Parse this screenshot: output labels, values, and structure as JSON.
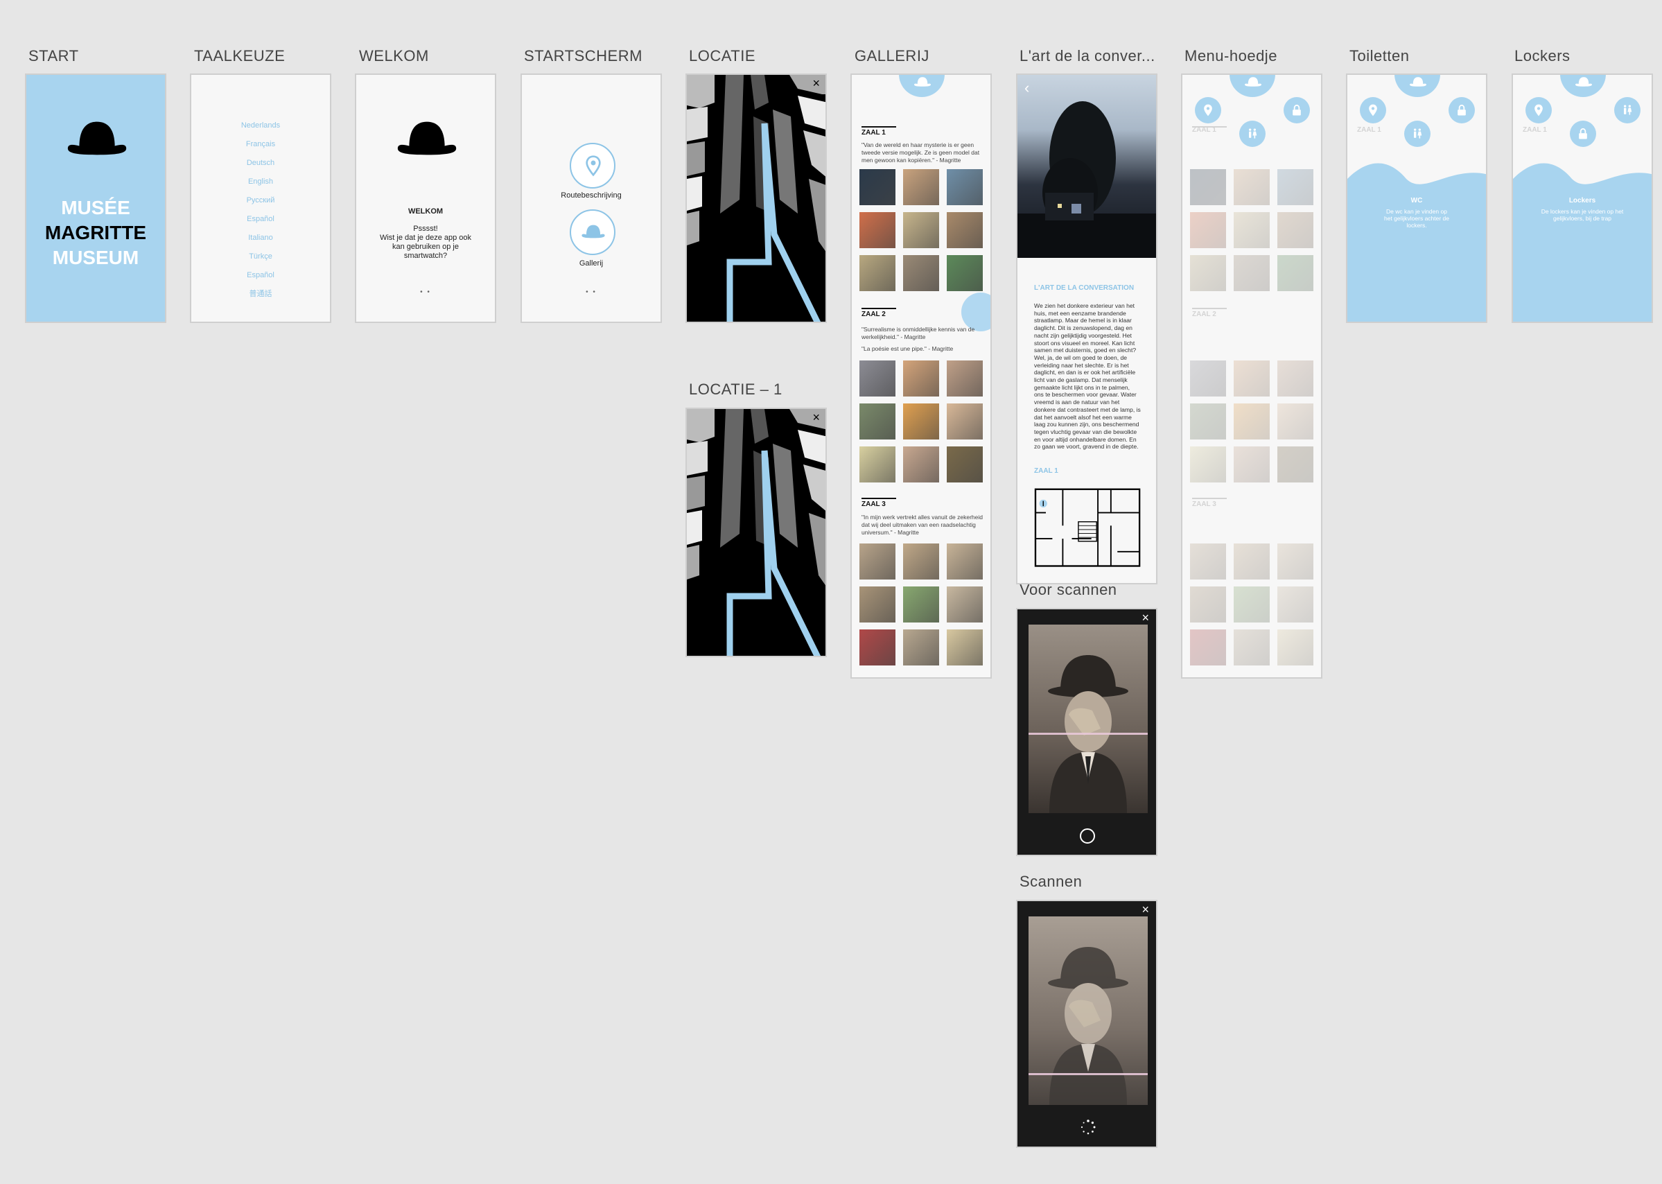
{
  "artboards": {
    "start": {
      "label": "START",
      "title_line1": "MUSÉE",
      "title_line2": "MAGRITTE",
      "title_line3": "MUSEUM"
    },
    "taalkeuze": {
      "label": "TAALKEUZE",
      "languages": [
        "Nederlands",
        "Français",
        "Deutsch",
        "English",
        "Русский",
        "Español",
        "Italiano",
        "Türkçe",
        "Español",
        "普通話"
      ]
    },
    "welkom": {
      "label": "WELKOM",
      "heading": "WELKOM",
      "line1": "Psssst!",
      "line2": "Wist je dat je deze app ook",
      "line3": "kan gebruiken op je",
      "line4": "smartwatch?",
      "dots": "• •"
    },
    "startscherm": {
      "label": "STARTSCHERM",
      "route_label": "Routebeschrijving",
      "gallery_label": "Gallerij",
      "dots": "• •"
    },
    "locatie": {
      "label": "LOCATIE"
    },
    "locatie1": {
      "label": "LOCATIE – 1"
    },
    "gallerij": {
      "label": "GALLERIJ",
      "zaal1": "ZAAL 1",
      "zaal1_quote": "\"Van de wereld en haar mysterie is er geen tweede versie mogelijk. Ze is geen model dat men gewoon kan kopiëren.\" - Magritte",
      "zaal2": "ZAAL 2",
      "zaal2_quote": "\"Surrealisme is onmiddellijke kennis van de werkelijkheid.\" - Magritte",
      "zaal2_quote2": "\"La poésie est une pipe.\" - Magritte",
      "zaal3": "ZAAL 3",
      "zaal3_quote": "\"In mijn werk vertrekt alles vanuit de zekerheid dat wij deel uitmaken van een raadselachtig universum.\" - Magritte"
    },
    "artwork": {
      "label": "L'art de la conver...",
      "title": "L'ART DE LA CONVERSATION",
      "body": "We zien het donkere exterieur van het huis, met een eenzame brandende straatlamp. Maar de hemel is in klaar daglicht. Dit is zenuwslopend, dag en nacht zijn gelijktijdig voorgesteld. Het stoort ons visueel en moreel. Kan licht samen met duisternis, goed en slecht? Wel, ja, de wil om goed te doen, de verleiding naar het slechte. Er is het daglicht, en dan is er ook het artificiële licht van de gaslamp. Dat menselijk gemaakte licht lijkt ons in te palmen, ons te beschermen voor gevaar. Water vreemd is aan de natuur van het donkere dat contrasteert met de lamp, is dat het aanvoelt alsof het een warme laag zou kunnen zijn, ons beschermend tegen vluchtig gevaar van die bewolkte en voor altijd onhandelbare domen. En zo gaan we voort, gravend in de diepte.",
      "zaal": "ZAAL 1"
    },
    "menu": {
      "label": "Menu-hoedje",
      "zaal1": "ZAAL 1",
      "zaal2": "ZAAL 2",
      "zaal3": "ZAAL 3"
    },
    "toiletten": {
      "label": "Toiletten",
      "zaal": "ZAAL 1",
      "heading": "WC",
      "text": "De wc kan je vinden op het gelijkvloers achter de lockers."
    },
    "lockers": {
      "label": "Lockers",
      "zaal": "ZAAL 1",
      "heading": "Lockers",
      "text": "De lockers kan je vinden op het gelijkvloers, bij de trap"
    },
    "voorscannen": {
      "label": "Voor scannen"
    },
    "scannen": {
      "label": "Scannen"
    }
  },
  "colors": {
    "accent": "#a8d4ef",
    "accent_text": "#8dc4e6",
    "canvas": "#e6e6e6"
  },
  "icons": [
    "bowler-hat-icon",
    "location-pin-icon",
    "lock-icon",
    "toilet-icon",
    "close-icon",
    "back-chevron-icon",
    "shutter-icon",
    "loading-spinner-icon"
  ]
}
